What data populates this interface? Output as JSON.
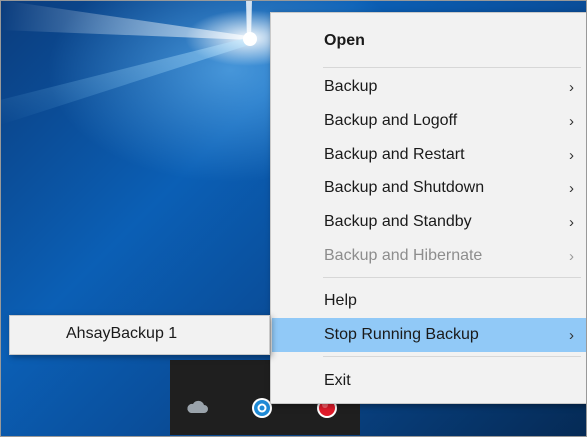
{
  "context_menu": {
    "items": [
      {
        "label": "Open",
        "bold": true,
        "has_submenu": false,
        "disabled": false
      },
      {
        "label": "Backup",
        "has_submenu": true,
        "disabled": false
      },
      {
        "label": "Backup and Logoff",
        "has_submenu": true,
        "disabled": false
      },
      {
        "label": "Backup and Restart",
        "has_submenu": true,
        "disabled": false
      },
      {
        "label": "Backup and Shutdown",
        "has_submenu": true,
        "disabled": false
      },
      {
        "label": "Backup and Standby",
        "has_submenu": true,
        "disabled": false
      },
      {
        "label": "Backup and Hibernate",
        "has_submenu": true,
        "disabled": true
      },
      {
        "label": "Help",
        "has_submenu": false,
        "disabled": false
      },
      {
        "label": "Stop Running Backup",
        "has_submenu": true,
        "disabled": false,
        "highlighted": true
      },
      {
        "label": "Exit",
        "has_submenu": false,
        "disabled": false
      }
    ],
    "arrow_glyph": "›",
    "highlight_color": "#91c9f7"
  },
  "submenu": {
    "items": [
      {
        "label": "AhsayBackup 1"
      }
    ]
  },
  "tray": {
    "icons": [
      "onedrive-cloud-icon",
      "ahsay-backup-icon",
      "red-status-icon"
    ]
  }
}
